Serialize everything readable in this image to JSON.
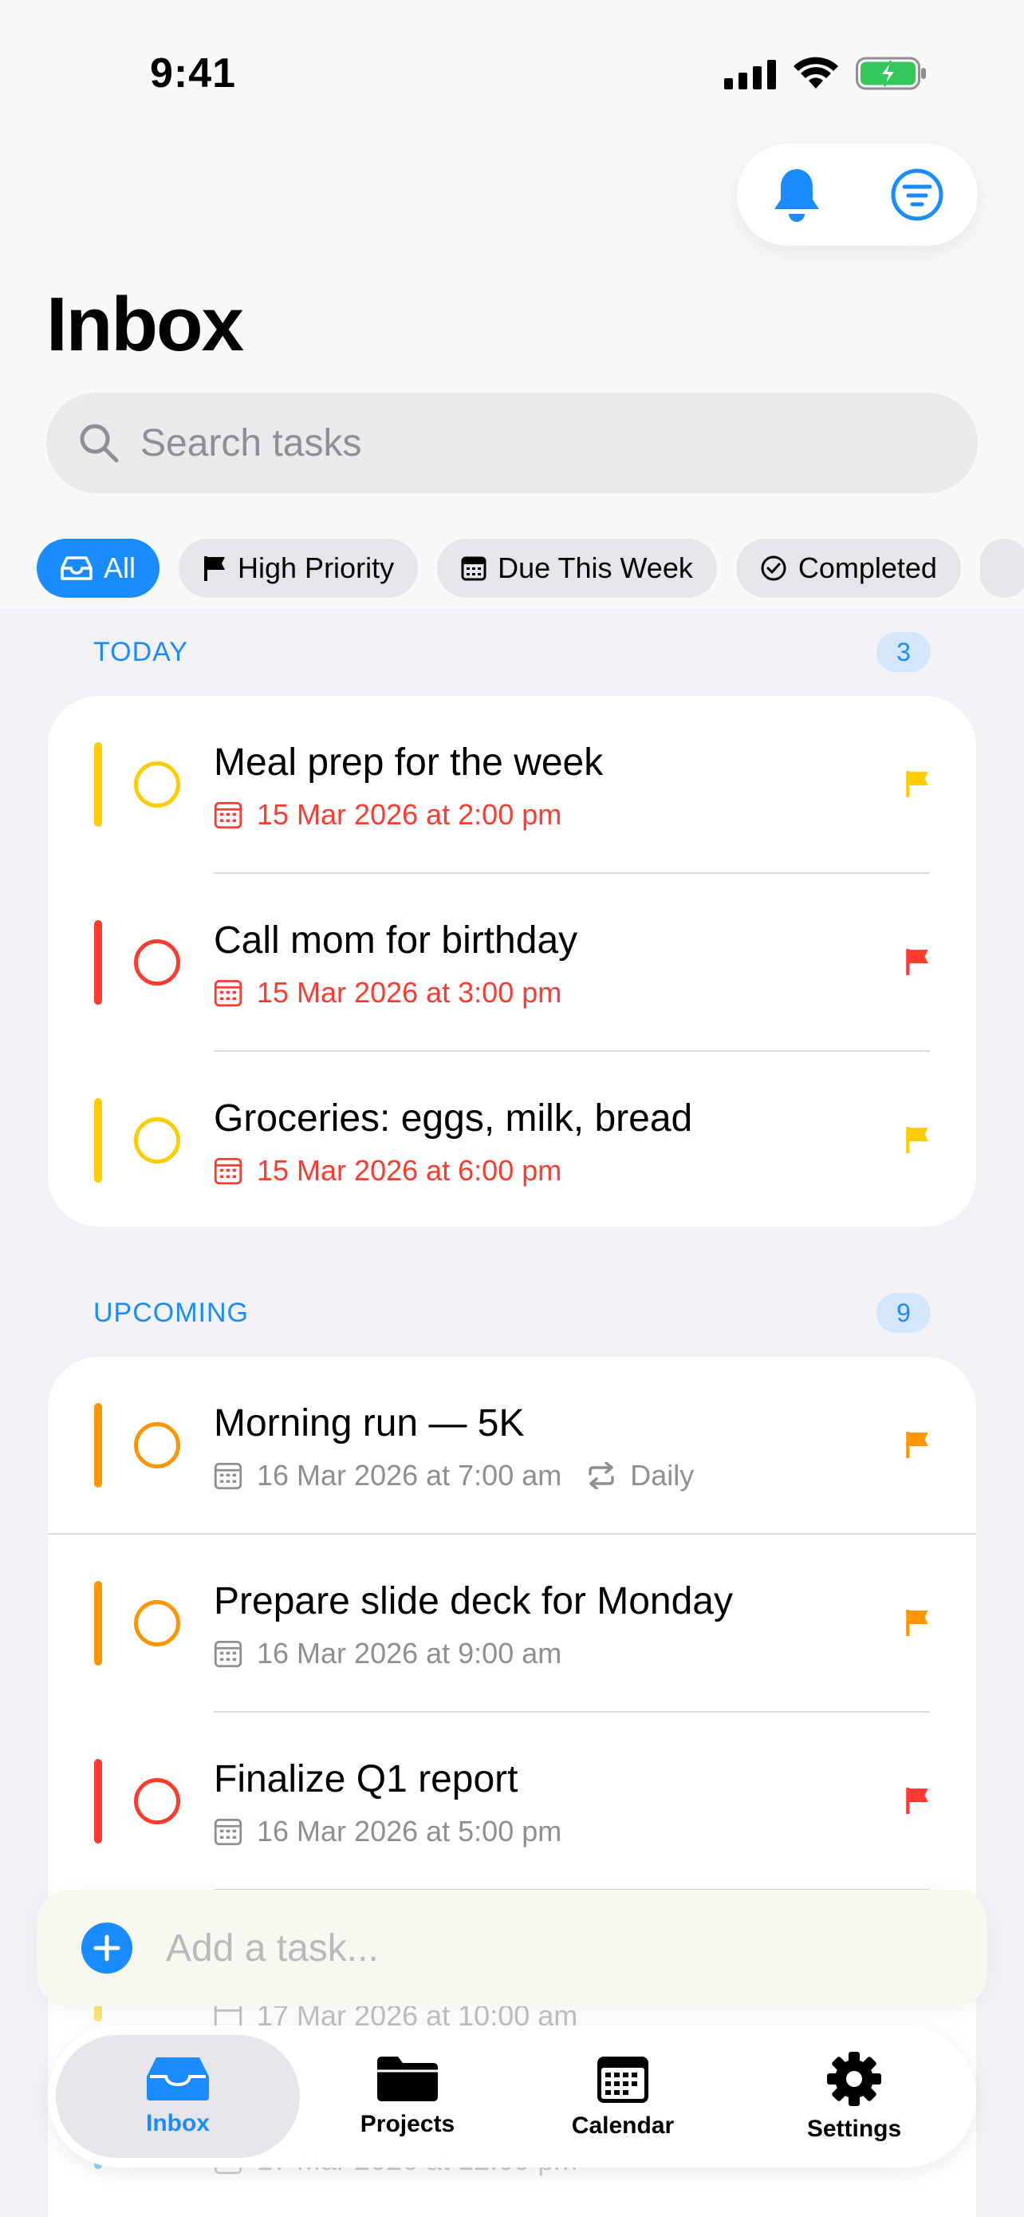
{
  "status": {
    "time": "9:41"
  },
  "page": {
    "title": "Inbox"
  },
  "search": {
    "placeholder": "Search tasks"
  },
  "filters": [
    {
      "label": "All",
      "icon": "tray-icon",
      "active": true
    },
    {
      "label": "High Priority",
      "icon": "flag-icon",
      "active": false
    },
    {
      "label": "Due This Week",
      "icon": "calendar-icon",
      "active": false
    },
    {
      "label": "Completed",
      "icon": "checkmark-circle-icon",
      "active": false
    }
  ],
  "sections": {
    "today": {
      "label": "TODAY",
      "count": "3",
      "tasks": [
        {
          "title": "Meal prep for the week",
          "due": "15 Mar 2026 at 2:00 pm",
          "priority_color": "#ffcc00",
          "due_color": "#ff3b30"
        },
        {
          "title": "Call mom for birthday",
          "due": "15 Mar 2026 at 3:00 pm",
          "priority_color": "#ff3b30",
          "due_color": "#ff3b30"
        },
        {
          "title": "Groceries: eggs, milk, bread",
          "due": "15 Mar 2026 at 6:00 pm",
          "priority_color": "#ffcc00",
          "due_color": "#ff3b30"
        }
      ]
    },
    "upcoming": {
      "label": "UPCOMING",
      "count": "9",
      "tasks": [
        {
          "title": "Morning run — 5K",
          "due": "16 Mar 2026 at 7:00 am",
          "repeat": "Daily",
          "priority_color": "#ff9500"
        },
        {
          "title": "Prepare slide deck for Monday",
          "due": "16 Mar 2026 at 9:00 am",
          "priority_color": "#ff9500"
        },
        {
          "title": "Finalize Q1 report",
          "due": "16 Mar 2026 at 5:00 pm",
          "priority_color": "#ff3b30"
        },
        {
          "title": "",
          "due": "17 Mar 2026 at 10:00 am",
          "priority_color": "#ffcc00"
        },
        {
          "title": "",
          "due": "17 Mar 2026 at 12:00 pm",
          "priority_color": "#1a8cff"
        }
      ]
    }
  },
  "add_task": {
    "placeholder": "Add a task..."
  },
  "tabs": [
    {
      "label": "Inbox",
      "icon": "tray-icon",
      "active": true
    },
    {
      "label": "Projects",
      "icon": "folder-icon",
      "active": false
    },
    {
      "label": "Calendar",
      "icon": "calendar-icon",
      "active": false
    },
    {
      "label": "Settings",
      "icon": "gear-icon",
      "active": false
    }
  ],
  "colors": {
    "accent": "#1a8cff",
    "overdue": "#ff3b30",
    "muted": "#8e8e93"
  }
}
